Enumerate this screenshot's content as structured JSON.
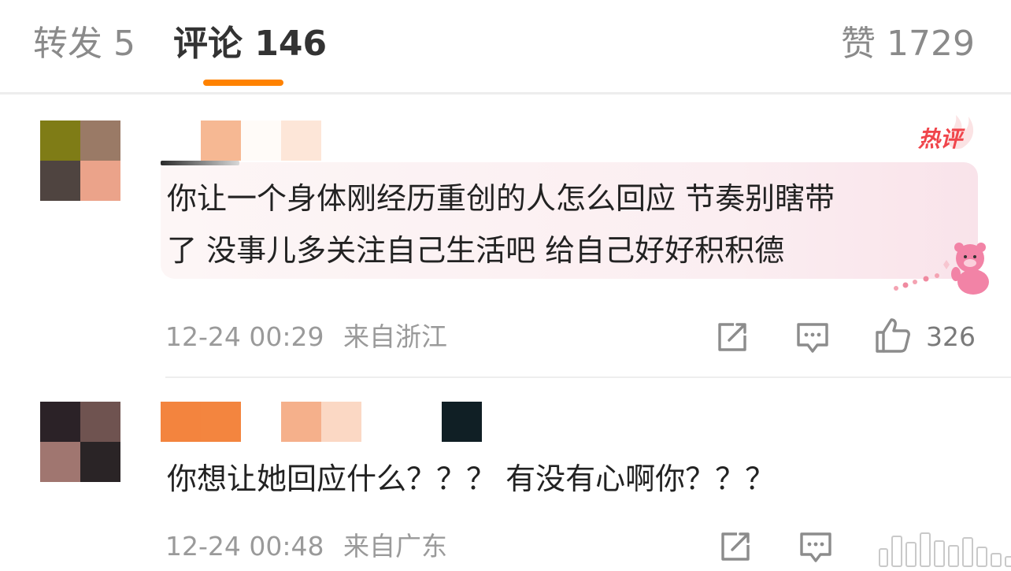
{
  "tabs": {
    "repost": "转发 5",
    "comments": "评论 146",
    "likes": "赞 1729"
  },
  "comments": [
    {
      "badge": "热评",
      "text_line1": "你让一个身体刚经历重创的人怎么回应 节奏别瞎带",
      "text_line2": "了 没事儿多关注自己生活吧 给自己好好积积德",
      "time": "12-24 00:29",
      "location": "来自浙江",
      "like_count": "326"
    },
    {
      "text_line1": "你想让她回应什么？？？ 有没有心啊你？？？",
      "time": "12-24 00:48",
      "location": "来自广东"
    }
  ],
  "colors": {
    "accent": "#ff8200",
    "hot": "#f0454b",
    "muted": "#9a9a9a"
  },
  "icons": [
    "repost-icon",
    "comment-icon",
    "like-icon"
  ]
}
